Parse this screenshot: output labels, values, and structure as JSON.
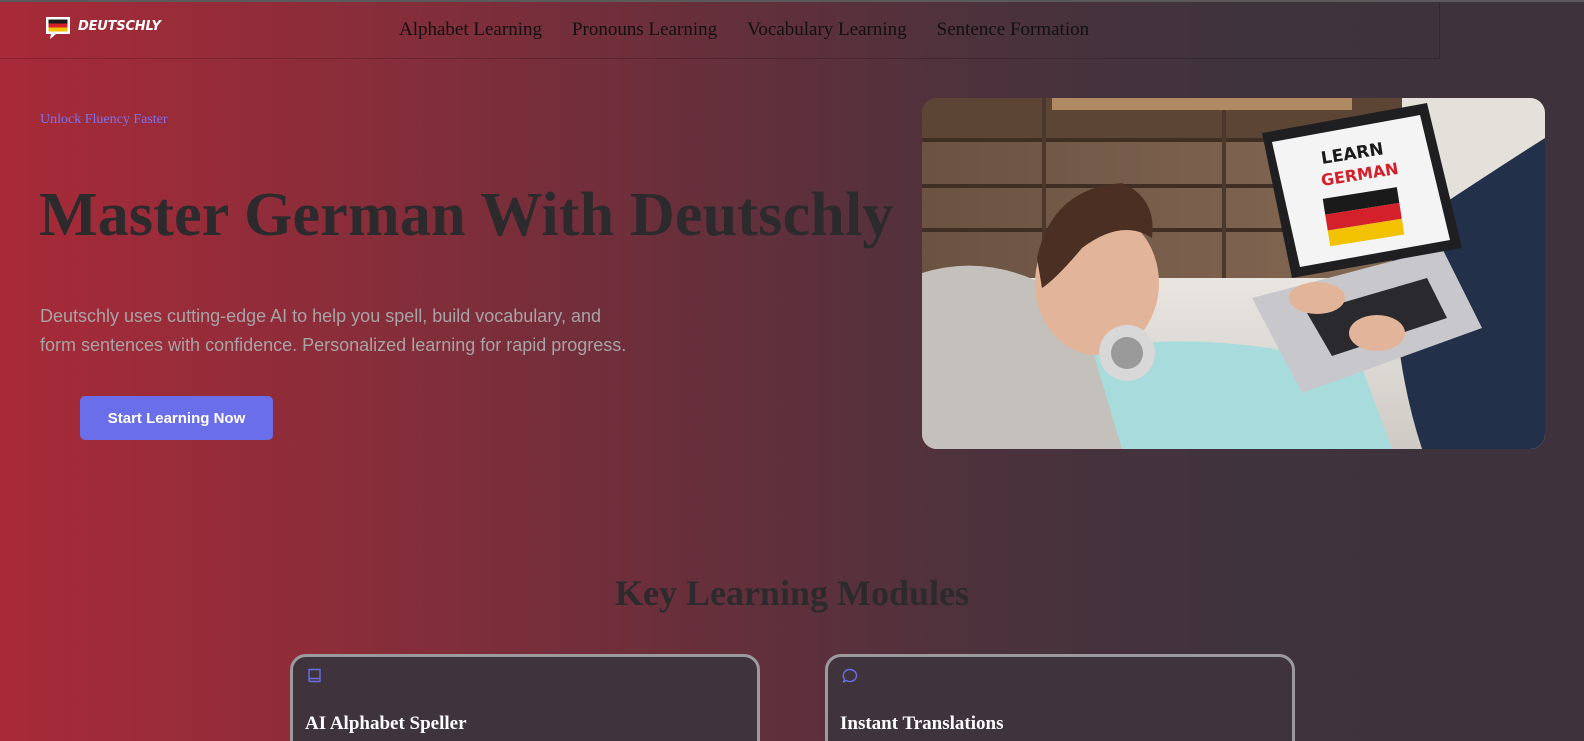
{
  "brand": {
    "name": "DEUTSCHLY"
  },
  "nav": {
    "items": [
      {
        "label": "Alphabet Learning"
      },
      {
        "label": "Pronouns Learning"
      },
      {
        "label": "Vocabulary Learning"
      },
      {
        "label": "Sentence Formation"
      }
    ]
  },
  "hero": {
    "eyebrow": "Unlock Fluency Faster",
    "title": "Master German With Deutschly",
    "description": "Deutschly uses cutting-edge AI to help you spell, build vocabulary, and form sentences with confidence. Personalized learning for rapid progress.",
    "cta_label": "Start Learning Now",
    "image": {
      "screen_line1": "LEARN",
      "screen_line2": "GERMAN"
    }
  },
  "modules": {
    "title": "Key Learning Modules",
    "cards": [
      {
        "title": "AI Alphabet Speller",
        "icon": "book-icon"
      },
      {
        "title": "Instant Translations",
        "icon": "chat-bubble-icon"
      }
    ]
  },
  "colors": {
    "accent": "#6a6ee8",
    "eyebrow": "#7b73f0",
    "gradient_start": "#a82a38",
    "gradient_end": "#3e333c"
  }
}
